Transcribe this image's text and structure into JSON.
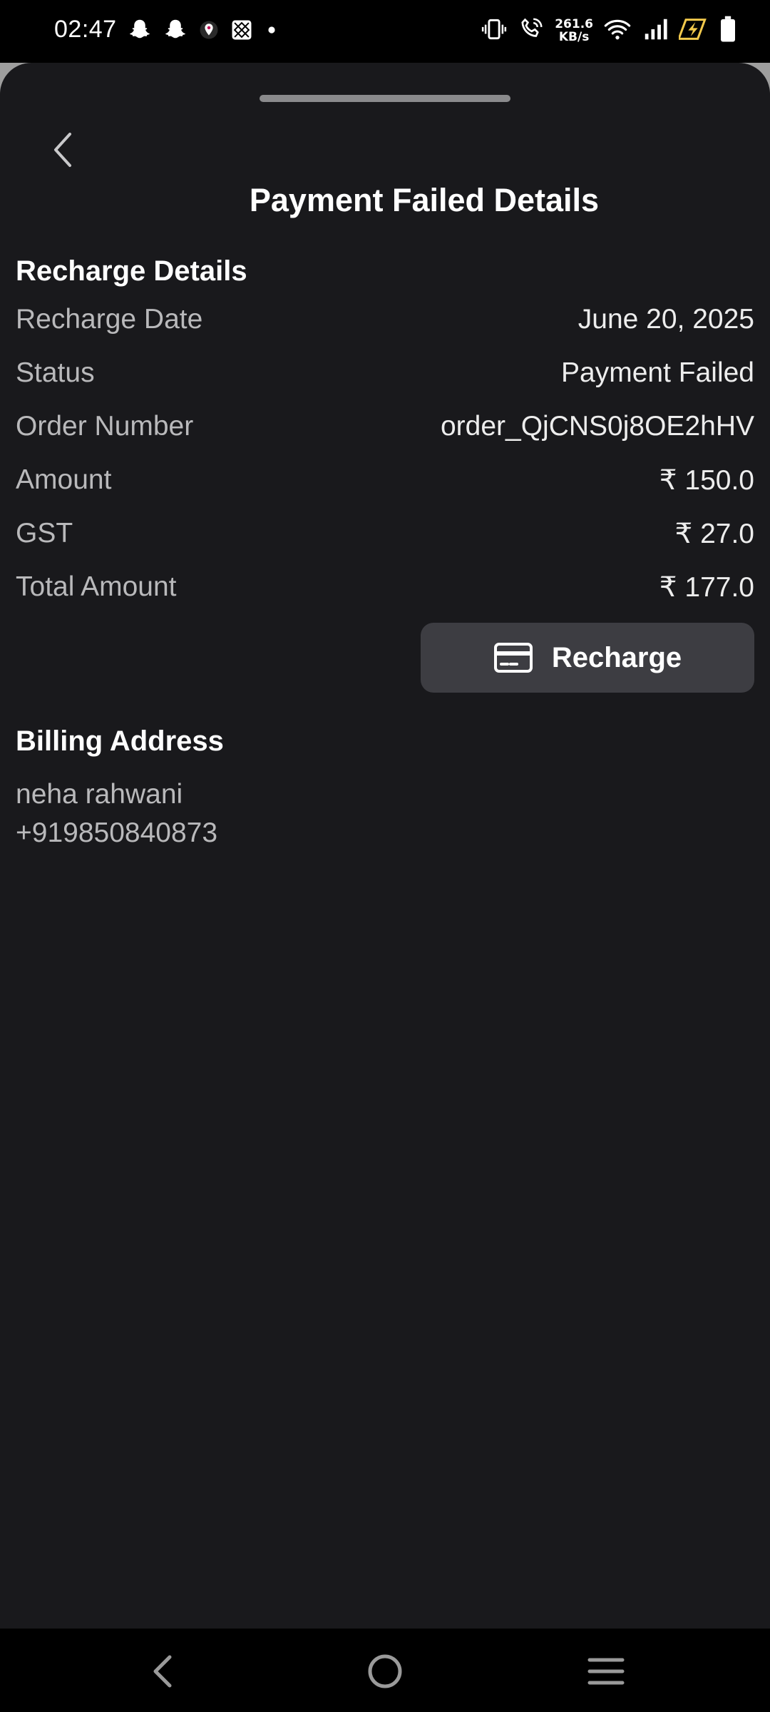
{
  "status_bar": {
    "time": "02:47",
    "net_speed_value": "261.6",
    "net_speed_unit": "KB/s",
    "left_icons": [
      "snapchat-icon",
      "snapchat-icon",
      "location-app-icon",
      "gallery-app-icon",
      "notification-dot-icon"
    ],
    "right_icons": [
      "vibrate-icon",
      "wifi-calling-icon",
      "wifi-icon",
      "signal-icon",
      "battery-saver-icon",
      "battery-icon"
    ]
  },
  "header": {
    "title": "Payment Failed Details"
  },
  "recharge_details": {
    "heading": "Recharge Details",
    "rows": [
      {
        "label": "Recharge Date",
        "value": "June 20, 2025"
      },
      {
        "label": "Status",
        "value": "Payment Failed"
      },
      {
        "label": "Order Number",
        "value": "order_QjCNS0j8OE2hHV"
      },
      {
        "label": "Amount",
        "value": "₹ 150.0"
      },
      {
        "label": "GST",
        "value": "₹ 27.0"
      },
      {
        "label": "Total Amount",
        "value": "₹ 177.0"
      }
    ]
  },
  "recharge_button": {
    "label": "Recharge",
    "icon": "credit-card-icon"
  },
  "billing_address": {
    "heading": "Billing Address",
    "name": "neha rahwani",
    "phone": "+919850840873"
  },
  "nav_bar": {
    "icons": [
      "nav-back-icon",
      "nav-home-icon",
      "nav-recents-icon"
    ]
  },
  "colors": {
    "sheet_background": "#19191c",
    "button_background": "#3d3d42",
    "label_text": "#b9b9bb",
    "value_text": "#ededed",
    "battery_saver": "#f2c94c"
  }
}
